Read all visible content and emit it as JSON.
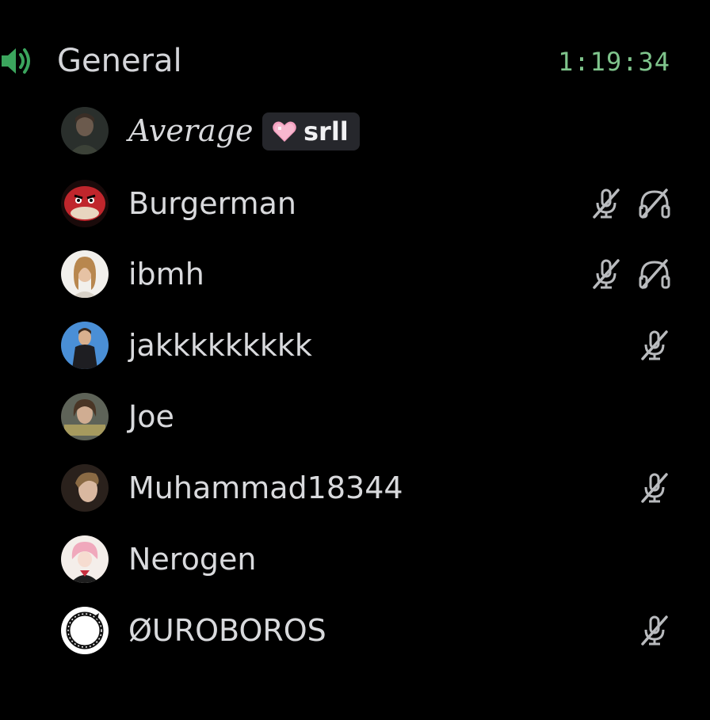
{
  "channel": {
    "icon": "speaker-icon",
    "name": "General",
    "timer": "1:19:34",
    "accent_color": "#3ba55d"
  },
  "members": [
    {
      "name": "Average",
      "tag": "srll",
      "tag_icon": "pink-heart-icon",
      "muted": false,
      "deafened": false
    },
    {
      "name": "Burgerman",
      "muted": true,
      "deafened": true
    },
    {
      "name": "ibmh",
      "muted": true,
      "deafened": true
    },
    {
      "name": "jakkkkkkkkk",
      "muted": true,
      "deafened": false
    },
    {
      "name": "Joe",
      "muted": false,
      "deafened": false
    },
    {
      "name": "Muhammad18344",
      "muted": true,
      "deafened": false
    },
    {
      "name": "Nerogen",
      "muted": false,
      "deafened": false
    },
    {
      "name": "ØUROBOROS",
      "muted": true,
      "deafened": false
    }
  ],
  "icons": {
    "muted": "muted-mic-icon",
    "deafened": "deafened-headphones-icon"
  }
}
